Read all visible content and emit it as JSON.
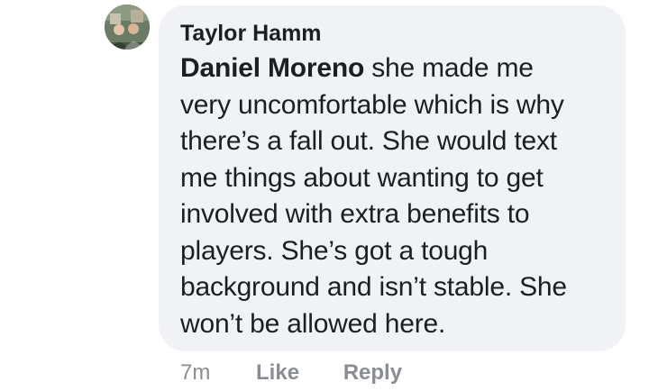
{
  "comment": {
    "author": "Taylor Hamm",
    "mention": "Daniel Moreno",
    "text_lines": [
      " she made me",
      "very uncomfortable which is why",
      "there’s a fall out. She would text",
      "me things about wanting to get",
      "involved with extra benefits to",
      "players. She’s got a tough",
      "background and isn’t stable. She",
      "won’t be allowed here."
    ],
    "avatar_icon": "profile-photo"
  },
  "actions": {
    "timestamp": "7m",
    "like_label": "Like",
    "reply_label": "Reply"
  },
  "colors": {
    "bubble_background": "#f0f2f5",
    "text": "#1c1e21",
    "secondary_text": "#8a8d91"
  }
}
